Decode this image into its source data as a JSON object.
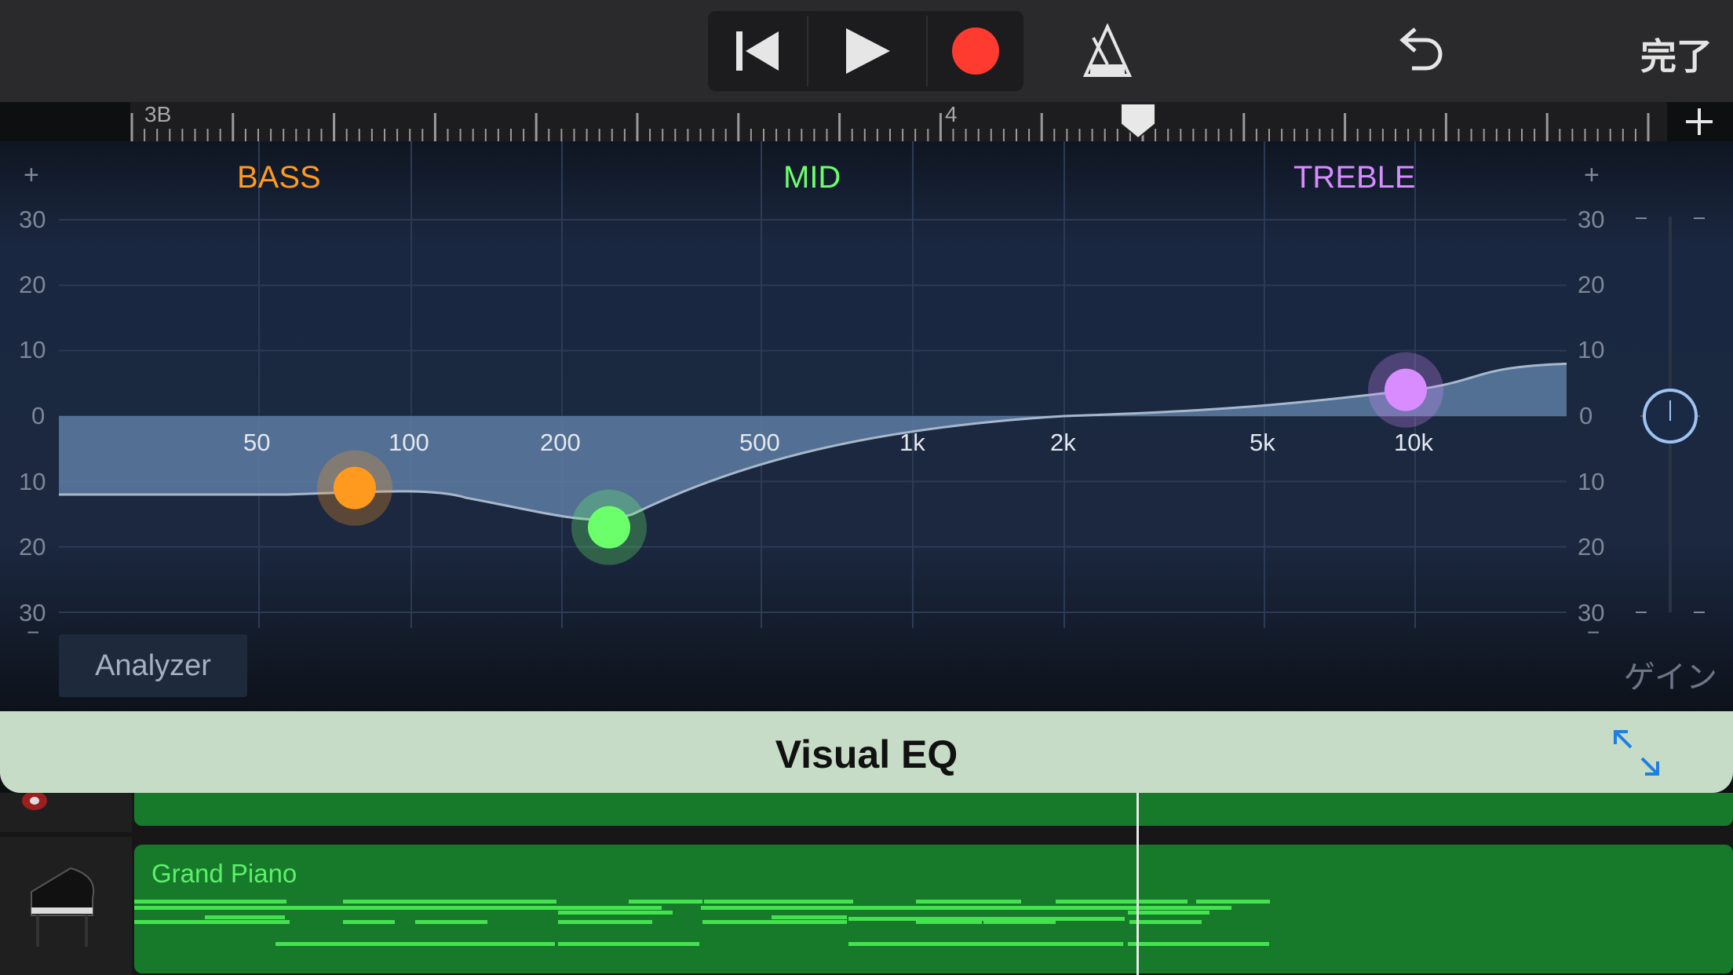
{
  "topbar": {
    "rewind_icon": "rewind-to-start-icon",
    "play_icon": "play-icon",
    "record_icon": "record-icon",
    "metronome_icon": "metronome-icon",
    "undo_icon": "undo-icon",
    "done_label": "完了"
  },
  "ruler": {
    "marker_a": "3B",
    "marker_b": "4",
    "add_icon": "plus-icon"
  },
  "eq": {
    "bands": {
      "bass": "BASS",
      "mid": "MID",
      "treble": "TREBLE"
    },
    "gain_scale": [
      "30",
      "20",
      "10",
      "0",
      "10",
      "20",
      "30"
    ],
    "freq_labels": [
      "50",
      "100",
      "200",
      "500",
      "1k",
      "2k",
      "5k",
      "10k"
    ],
    "plus": "+",
    "minus": "−",
    "analyzer_label": "Analyzer",
    "gain_label": "ゲイン",
    "points": {
      "bass": {
        "freq": "100",
        "gain_db": -11
      },
      "mid": {
        "freq": "250",
        "gain_db": -17
      },
      "treble": {
        "freq": "10k",
        "gain_db": 4
      }
    },
    "gain_knob_db": 0,
    "colors": {
      "bass": "#ff9a1f",
      "mid": "#6cff6c",
      "treble": "#d88cff",
      "curve_fill": "#5d7da3"
    }
  },
  "plugin_header": {
    "title": "Visual EQ",
    "expand_icon": "expand-arrows-icon"
  },
  "tracks": [
    {
      "name": "",
      "icon": "guitar-icon"
    },
    {
      "name": "Grand Piano",
      "icon": "grand-piano-icon"
    }
  ]
}
